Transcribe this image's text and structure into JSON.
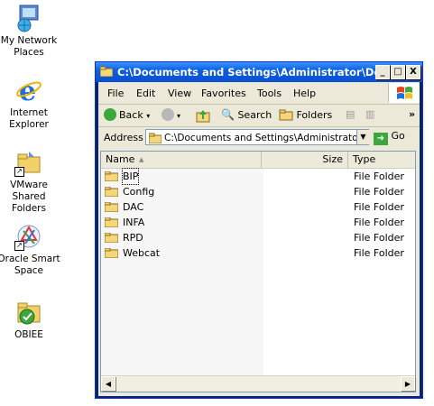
{
  "desktop": {
    "icons": [
      {
        "label": "My Network Places",
        "icon": "network-places-icon"
      },
      {
        "label": "Internet Explorer",
        "icon": "internet-explorer-icon"
      },
      {
        "label": "VMware Shared Folders",
        "icon": "vmware-shared-folders-icon"
      },
      {
        "label": "Oracle Smart Space",
        "icon": "oracle-smart-space-icon"
      },
      {
        "label": "OBIEE",
        "icon": "obiee-icon"
      }
    ]
  },
  "window": {
    "title": "C:\\Documents and Settings\\Administrator\\Desk...",
    "minimize": "_",
    "maximize": "□",
    "close": "X"
  },
  "menubar": {
    "items": [
      "File",
      "Edit",
      "View",
      "Favorites",
      "Tools",
      "Help"
    ]
  },
  "toolbar": {
    "back": "Back",
    "search": "Search",
    "folders": "Folders",
    "overflow": "»"
  },
  "address": {
    "label": "Address",
    "value": "C:\\Documents and Settings\\Administrator\\D",
    "go": "Go"
  },
  "list": {
    "columns": {
      "name": "Name",
      "size": "Size",
      "type": "Type"
    },
    "items": [
      {
        "name": "BIP",
        "type": "File Folder"
      },
      {
        "name": "Config",
        "type": "File Folder"
      },
      {
        "name": "DAC",
        "type": "File Folder"
      },
      {
        "name": "INFA",
        "type": "File Folder"
      },
      {
        "name": "RPD",
        "type": "File Folder"
      },
      {
        "name": "Webcat",
        "type": "File Folder"
      }
    ]
  },
  "colors": {
    "titlebar": "#0a5fe0",
    "folder": "#f5d77a",
    "frame": "#ece9d8"
  }
}
